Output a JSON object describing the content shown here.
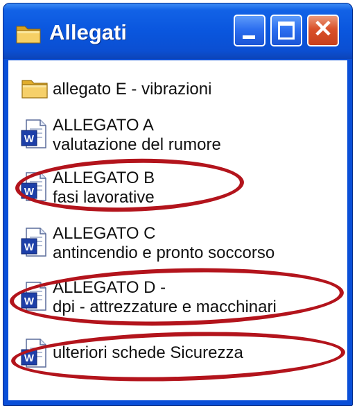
{
  "window": {
    "title": "Allegati",
    "title_icon": "folder-icon",
    "controls": {
      "minimize": "minimize-icon",
      "maximize": "maximize-icon",
      "close": "close-icon",
      "close_glyph": "✕"
    }
  },
  "items": [
    {
      "icon": "folder-icon",
      "line1": "allegato E - vibrazioni",
      "line2": "",
      "circled": false
    },
    {
      "icon": "word-document-icon",
      "line1": "ALLEGATO A",
      "line2": "valutazione del rumore",
      "circled": false
    },
    {
      "icon": "word-document-icon",
      "line1": "ALLEGATO B",
      "line2": "fasi lavorative",
      "circled": true
    },
    {
      "icon": "word-document-icon",
      "line1": "ALLEGATO C",
      "line2": "antincendio e pronto soccorso",
      "circled": false
    },
    {
      "icon": "word-document-icon",
      "line1": "ALLEGATO D -",
      "line2": "dpi - attrezzature e macchinari",
      "circled": true
    },
    {
      "icon": "word-document-icon",
      "line1": "ulteriori schede Sicurezza",
      "line2": "",
      "circled": true
    }
  ],
  "colors": {
    "titlebar": "#0a56de",
    "highlight_ring": "#b3141c",
    "close_button": "#d9512a",
    "folder": "#f2c54a",
    "word_icon": "#1d3fa8"
  }
}
